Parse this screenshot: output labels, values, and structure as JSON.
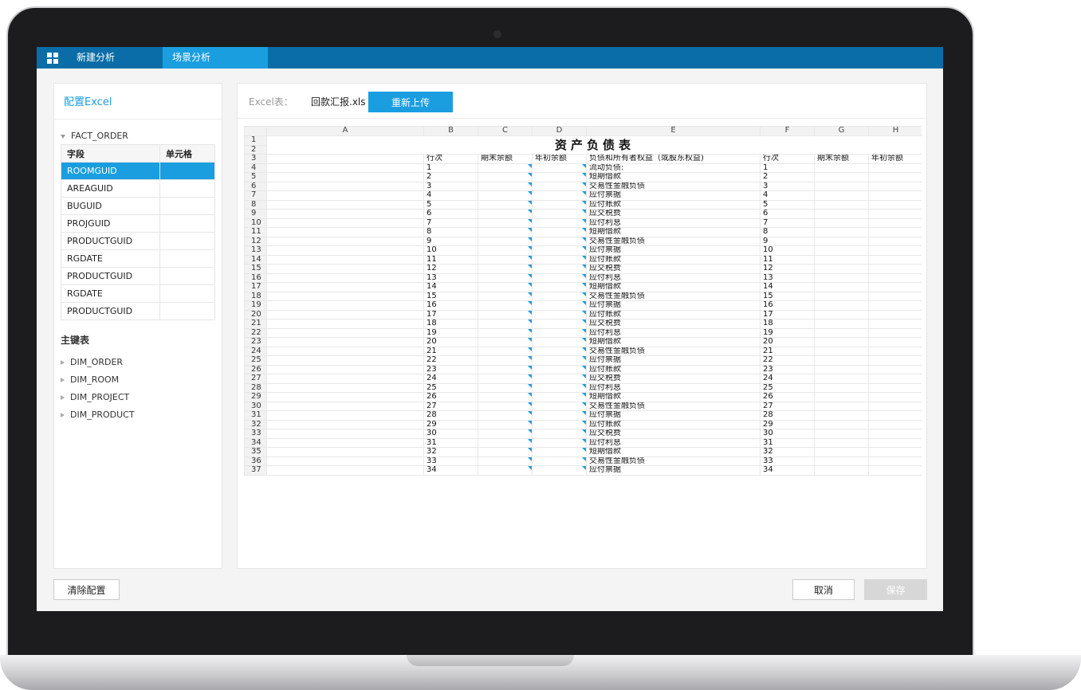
{
  "tabs": [
    {
      "label": "新建分析",
      "active": false
    },
    {
      "label": "场景分析",
      "active": true
    }
  ],
  "left_panel": {
    "title": "配置Excel",
    "fact_table": "FACT_ORDER",
    "field_headers": {
      "field": "字段",
      "cell": "单元格"
    },
    "fields": [
      "ROOMGUID",
      "AREAGUID",
      "BUGUID",
      "PROJGUID",
      "PRODUCTGUID",
      "RGDATE",
      "PRODUCTGUID",
      "RGDATE",
      "PRODUCTGUID"
    ],
    "selected_field_index": 0,
    "primary_key_label": "主键表",
    "dim_tables": [
      "DIM_ORDER",
      "DIM_ROOM",
      "DIM_PROJECT",
      "DIM_PRODUCT"
    ]
  },
  "main_panel": {
    "excel_label": "Excel表：",
    "file_name": "回款汇报.xls",
    "reupload_label": "重新上传"
  },
  "sheet": {
    "columns": [
      "A",
      "B",
      "C",
      "D",
      "E",
      "F",
      "G",
      "H"
    ],
    "title": "资产负债表",
    "header_row": {
      "B": "行次",
      "C": "期末余额",
      "D": "年初余额",
      "E": "负债和所有者权益（或股东权益)",
      "F": "行次",
      "G": "期末余额",
      "H": "年初余额"
    },
    "items": [
      "流动负债:",
      "短期借款",
      "交易性金融负债",
      "应付票据",
      "应付账款",
      "应交税费",
      "应付利息",
      "短期借款",
      "交易性金融负债",
      "应付票据",
      "应付账款",
      "应交税费",
      "应付利息",
      "短期借款",
      "交易性金融负债",
      "应付票据",
      "应付账款",
      "应交税费",
      "应付利息",
      "短期借款",
      "交易性金融负债",
      "应付票据",
      "应付账款",
      "应交税费",
      "应付利息",
      "短期借款",
      "交易性金融负债",
      "应付票据",
      "应付账款",
      "应交税费",
      "应付利息",
      "短期借款",
      "交易性金融负债",
      "应付票据"
    ],
    "row_numbers": [
      "1",
      "2",
      "3",
      "4",
      "5",
      "6",
      "7",
      "8",
      "9",
      "10",
      "11",
      "12",
      "13",
      "14",
      "15",
      "16",
      "17",
      "18",
      "19",
      "20",
      "21",
      "22",
      "23",
      "24",
      "25",
      "26",
      "27",
      "28",
      "29",
      "30",
      "31",
      "32",
      "33",
      "34",
      "35",
      "36",
      "37"
    ],
    "line_numbers": [
      "1",
      "2",
      "3",
      "4",
      "5",
      "6",
      "7",
      "8",
      "9",
      "10",
      "11",
      "12",
      "13",
      "14",
      "15",
      "16",
      "17",
      "18",
      "19",
      "20",
      "21",
      "22",
      "23",
      "24",
      "25",
      "26",
      "27",
      "28",
      "29",
      "30",
      "31",
      "32",
      "33",
      "34"
    ]
  },
  "footer": {
    "clear_label": "清除配置",
    "cancel_label": "取消",
    "save_label": "保存"
  },
  "colors": {
    "topbar": "#0a6da7",
    "accent": "#1a9ee0",
    "disabled": "#d7d7d7"
  }
}
